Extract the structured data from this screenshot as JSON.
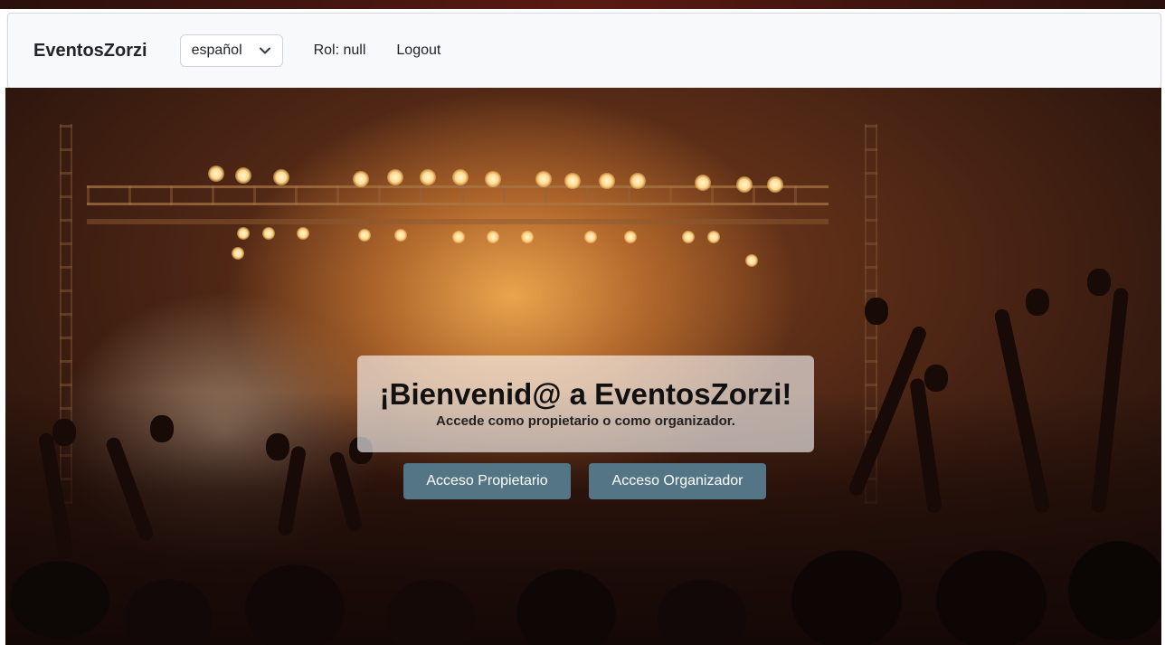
{
  "navbar": {
    "brand": "EventosZorzi",
    "language": {
      "selected": "español",
      "icon": "chevron-down-icon"
    },
    "role_text": "Rol: null",
    "logout_label": "Logout"
  },
  "hero": {
    "title": "¡Bienvenid@ a EventosZorzi!",
    "subtitle": "Accede como propietario o como organizador.",
    "buttons": {
      "owner_label": "Acceso Propietario",
      "organizer_label": "Acceso Organizador"
    }
  },
  "colors": {
    "navbar_bg": "#f8f9fa",
    "button_bg": "#547585",
    "button_text": "#ffffff",
    "title_text": "#111111"
  }
}
